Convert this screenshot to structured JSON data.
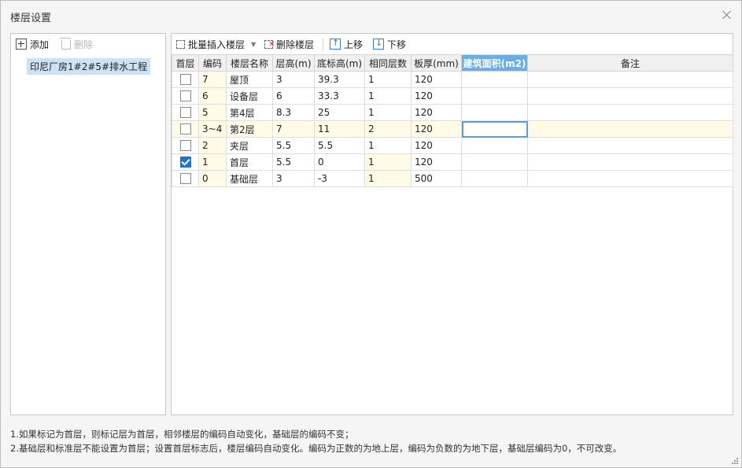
{
  "window": {
    "title": "楼层设置"
  },
  "left_toolbar": {
    "add_label": "添加",
    "delete_label": "删除"
  },
  "tree": {
    "items": [
      {
        "label": "印尼厂房1#2#5#排水工程"
      }
    ]
  },
  "right_toolbar": {
    "batch_insert_label": "批量插入楼层",
    "delete_floor_label": "删除楼层",
    "move_up_label": "上移",
    "move_down_label": "下移"
  },
  "table": {
    "columns": [
      "首层",
      "编码",
      "楼层名称",
      "层高(m)",
      "底标高(m)",
      "相同层数",
      "板厚(mm)",
      "建筑面积(m2)",
      "备注"
    ],
    "rows": [
      {
        "first": false,
        "code": "7",
        "name": "屋顶",
        "height": "3",
        "bottom": "39.3",
        "same": "1",
        "thickness": "120",
        "area": "",
        "note": ""
      },
      {
        "first": false,
        "code": "6",
        "name": "设备层",
        "height": "6",
        "bottom": "33.3",
        "same": "1",
        "thickness": "120",
        "area": "",
        "note": ""
      },
      {
        "first": false,
        "code": "5",
        "name": "第4层",
        "height": "8.3",
        "bottom": "25",
        "same": "1",
        "thickness": "120",
        "area": "",
        "note": ""
      },
      {
        "first": false,
        "code": "3~4",
        "name": "第2层",
        "height": "7",
        "bottom": "11",
        "same": "2",
        "thickness": "120",
        "area": "",
        "note": ""
      },
      {
        "first": false,
        "code": "2",
        "name": "夹层",
        "height": "5.5",
        "bottom": "5.5",
        "same": "1",
        "thickness": "120",
        "area": "",
        "note": ""
      },
      {
        "first": true,
        "code": "1",
        "name": "首层",
        "height": "5.5",
        "bottom": "0",
        "same": "1",
        "thickness": "120",
        "area": "",
        "note": ""
      },
      {
        "first": false,
        "code": "0",
        "name": "基础层",
        "height": "3",
        "bottom": "-3",
        "same": "1",
        "thickness": "500",
        "area": "",
        "note": ""
      }
    ]
  },
  "notes": [
    "1.如果标记为首层，则标记层为首层，相邻楼层的编码自动变化，基础层的编码不变；",
    "2.基础层和标准层不能设置为首层；设置首层标志后，楼层编码自动变化。编码为正数的为地上层，编码为负数的为地下层，基础层编码为0，不可改变。"
  ],
  "colors": {
    "accent": "#6aaee8",
    "checkbox_checked": "#1f73d0",
    "tree_selected": "#cce3f7"
  }
}
